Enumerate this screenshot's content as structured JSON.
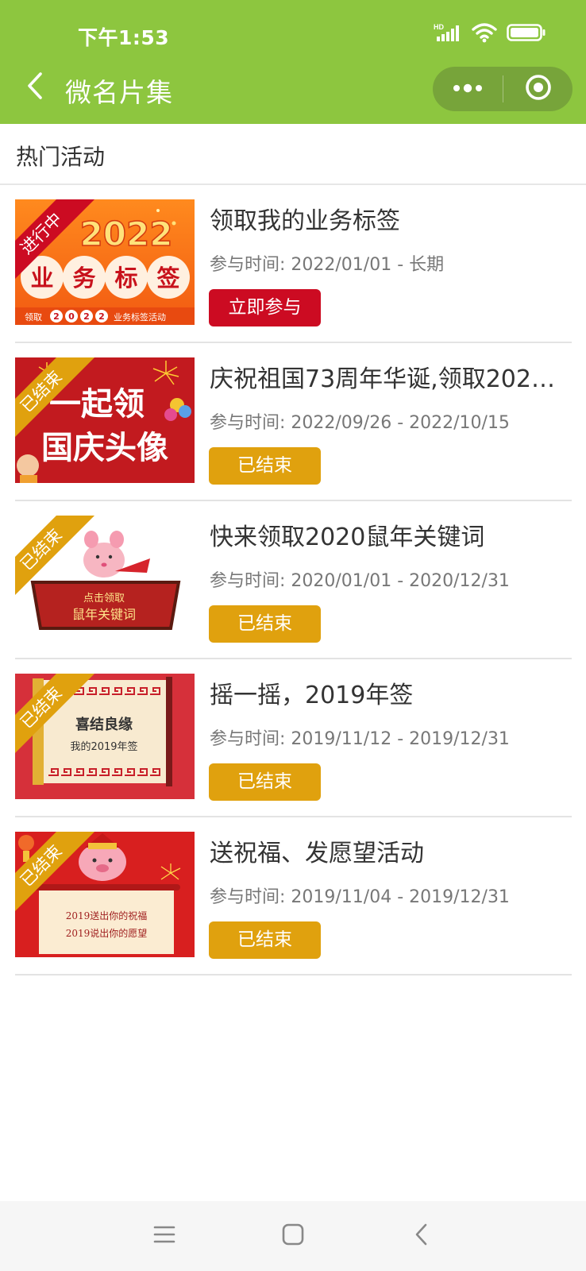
{
  "status_bar": {
    "time": "下午1:53",
    "network_label": "HD"
  },
  "nav": {
    "title": "微名片集"
  },
  "section": {
    "title": "热门活动"
  },
  "colors": {
    "nav_bg": "#8dc63f",
    "active": "#cc0b22",
    "ended": "#e0a10e"
  },
  "activities": [
    {
      "status": "进行中",
      "title": "领取我的业务标签",
      "time": "参与时间: 2022/01/01 - 长期",
      "button": "立即参与",
      "image": {
        "line1": "业务标签",
        "big_text": "2022",
        "chars": [
          "业",
          "务",
          "标",
          "签"
        ],
        "footer_left": "领取",
        "footer_digits": [
          "2",
          "0",
          "2",
          "2"
        ],
        "footer_right": "业务标签活动"
      }
    },
    {
      "status": "已结束",
      "title": "庆祝祖国73周年华诞,领取2022…",
      "time": "参与时间: 2022/09/26 - 2022/10/15",
      "button": "已结束",
      "image": {
        "line1": "一起领",
        "line2": "国庆头像"
      }
    },
    {
      "status": "已结束",
      "title": "快来领取2020鼠年关键词",
      "time": "参与时间: 2020/01/01 - 2020/12/31",
      "button": "已结束",
      "image": {
        "line1": "点击领取",
        "line2": "鼠年关键词"
      }
    },
    {
      "status": "已结束",
      "title": "摇一摇，2019年签",
      "time": "参与时间: 2019/11/12 - 2019/12/31",
      "button": "已结束",
      "image": {
        "line1": "喜结良缘",
        "line2": "我的2019年签"
      }
    },
    {
      "status": "已结束",
      "title": "送祝福、发愿望活动",
      "time": "参与时间: 2019/11/04 - 2019/12/31",
      "button": "已结束",
      "image": {
        "line1": "2019送出你的祝福",
        "line2": "2019说出你的愿望"
      }
    }
  ]
}
